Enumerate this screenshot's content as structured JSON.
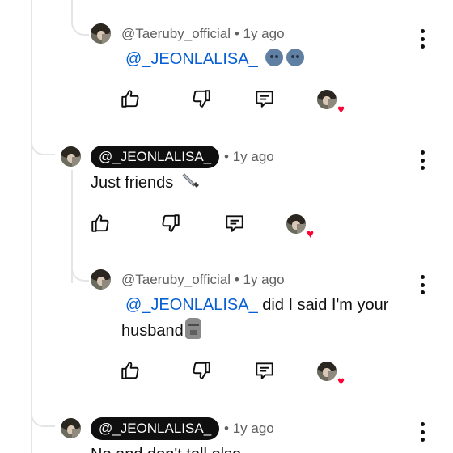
{
  "comments": [
    {
      "author": "@Taeruby_official",
      "time": "1y ago",
      "mention": "@_JEONLALISA_",
      "text_after": "",
      "emoji": "moon-face-emoji-x2"
    },
    {
      "author": "@_JEONLALISA_",
      "time": "1y ago",
      "text": "Just friends",
      "emoji": "knife-emoji"
    },
    {
      "author": "@Taeruby_official",
      "time": "1y ago",
      "mention": "@_JEONLALISA_",
      "text_line1": "did I said I'm your",
      "text_line2": "husband",
      "emoji": "moai-emoji"
    },
    {
      "author": "@_JEONLALISA_",
      "time": "1y ago",
      "text_partial": "No and don't tell else"
    }
  ],
  "separator": "•",
  "icons": {
    "like": "thumbs-up-icon",
    "dislike": "thumbs-down-icon",
    "reply": "reply-comment-icon",
    "creator_heart": "creator-heart-icon",
    "more": "more-vertical-icon"
  },
  "colors": {
    "mention": "#065fd4",
    "badge_bg": "#0f0f0f",
    "heart": "#ff0033",
    "meta": "#606060"
  }
}
